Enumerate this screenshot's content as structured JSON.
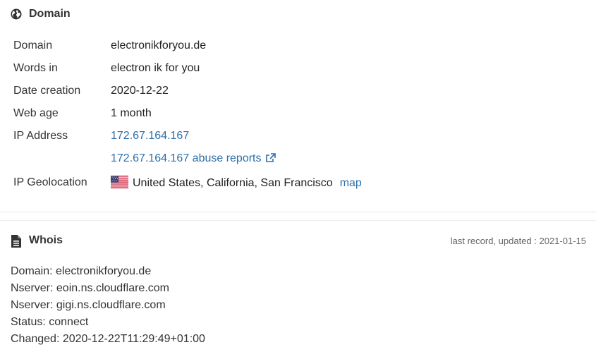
{
  "domain_section": {
    "title": "Domain",
    "icon": "globe-icon",
    "rows": {
      "domain": {
        "label": "Domain",
        "value": "electronikforyou.de"
      },
      "words": {
        "label": "Words in",
        "value": "electron ik for you"
      },
      "date_creation": {
        "label": "Date creation",
        "value": "2020-12-22"
      },
      "web_age": {
        "label": "Web age",
        "value": "1 month"
      },
      "ip_address": {
        "label": "IP Address",
        "value": "172.67.164.167"
      },
      "abuse": {
        "value": "172.67.164.167 abuse reports"
      },
      "geolocation": {
        "label": "IP Geolocation",
        "value": "United States, California, San Francisco",
        "map_label": "map"
      }
    }
  },
  "whois_section": {
    "title": "Whois",
    "icon": "document-icon",
    "updated": "last record, updated : 2021-01-15",
    "lines": [
      "Domain: electronikforyou.de",
      "Nserver: eoin.ns.cloudflare.com",
      "Nserver: gigi.ns.cloudflare.com",
      "Status: connect",
      "Changed: 2020-12-22T11:29:49+01:00"
    ]
  },
  "colors": {
    "link": "#2e6ea8",
    "text": "#333333"
  }
}
